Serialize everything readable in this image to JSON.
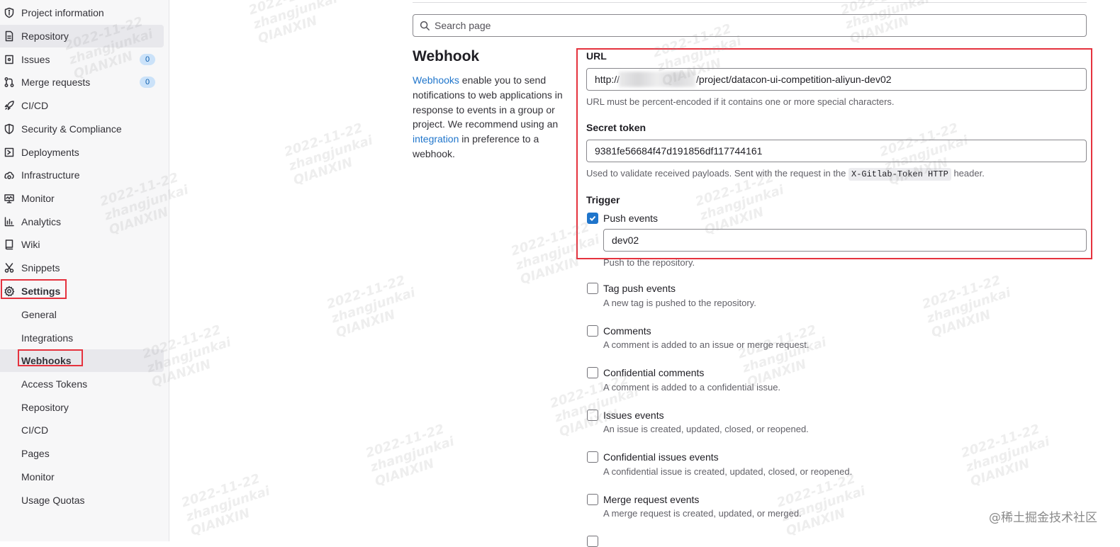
{
  "sidebar": {
    "items": [
      {
        "label": "Project information",
        "icon": "info-icon"
      },
      {
        "label": "Repository",
        "icon": "document-icon",
        "active": true
      },
      {
        "label": "Issues",
        "icon": "issues-icon",
        "count": "0"
      },
      {
        "label": "Merge requests",
        "icon": "merge-request-icon",
        "count": "0"
      },
      {
        "label": "CI/CD",
        "icon": "rocket-icon"
      },
      {
        "label": "Security & Compliance",
        "icon": "shield-icon"
      },
      {
        "label": "Deployments",
        "icon": "deployments-icon"
      },
      {
        "label": "Infrastructure",
        "icon": "cloud-gear-icon"
      },
      {
        "label": "Monitor",
        "icon": "monitor-icon"
      },
      {
        "label": "Analytics",
        "icon": "chart-icon"
      },
      {
        "label": "Wiki",
        "icon": "book-icon"
      },
      {
        "label": "Snippets",
        "icon": "scissors-icon"
      },
      {
        "label": "Settings",
        "icon": "gear-icon",
        "bold": true
      }
    ],
    "settings_sub": [
      {
        "label": "General"
      },
      {
        "label": "Integrations"
      },
      {
        "label": "Webhooks",
        "active": true
      },
      {
        "label": "Access Tokens"
      },
      {
        "label": "Repository"
      },
      {
        "label": "CI/CD"
      },
      {
        "label": "Pages"
      },
      {
        "label": "Monitor"
      },
      {
        "label": "Usage Quotas"
      }
    ]
  },
  "search": {
    "placeholder": "Search page"
  },
  "page": {
    "title": "Webhook",
    "desc_link1": "Webhooks",
    "desc_text1": " enable you to send notifications to web applications in response to events in a group or project. We recommend using an ",
    "desc_link2": "integration",
    "desc_text2": " in preference to a webhook."
  },
  "form": {
    "url_label": "URL",
    "url_prefix": "http://",
    "url_suffix": "/project/datacon-ui-competition-aliyun-dev02",
    "url_help": "URL must be percent-encoded if it contains one or more special characters.",
    "token_label": "Secret token",
    "token_value": "9381fe56684f47d191856df117744161",
    "token_help_pre": "Used to validate received payloads. Sent with the request in the ",
    "token_help_code": "X-Gitlab-Token HTTP",
    "token_help_post": " header.",
    "trigger_label": "Trigger",
    "push_label": "Push events",
    "push_branch": "dev02",
    "push_help": "Push to the repository.",
    "triggers": [
      {
        "label": "Tag push events",
        "help": "A new tag is pushed to the repository."
      },
      {
        "label": "Comments",
        "help": "A comment is added to an issue or merge request."
      },
      {
        "label": "Confidential comments",
        "help": "A comment is added to a confidential issue."
      },
      {
        "label": "Issues events",
        "help": "An issue is created, updated, closed, or reopened."
      },
      {
        "label": "Confidential issues events",
        "help": "A confidential issue is created, updated, closed, or reopened."
      },
      {
        "label": "Merge request events",
        "help": "A merge request is created, updated, or merged."
      }
    ]
  },
  "watermark": {
    "date": "2022-11-22",
    "user": "zhangjunkai",
    "org": "QIANXIN"
  },
  "site_mark": "@稀土掘金技术社区",
  "colors": {
    "accent": "#1f75cb",
    "highlight": "#e5323e"
  }
}
